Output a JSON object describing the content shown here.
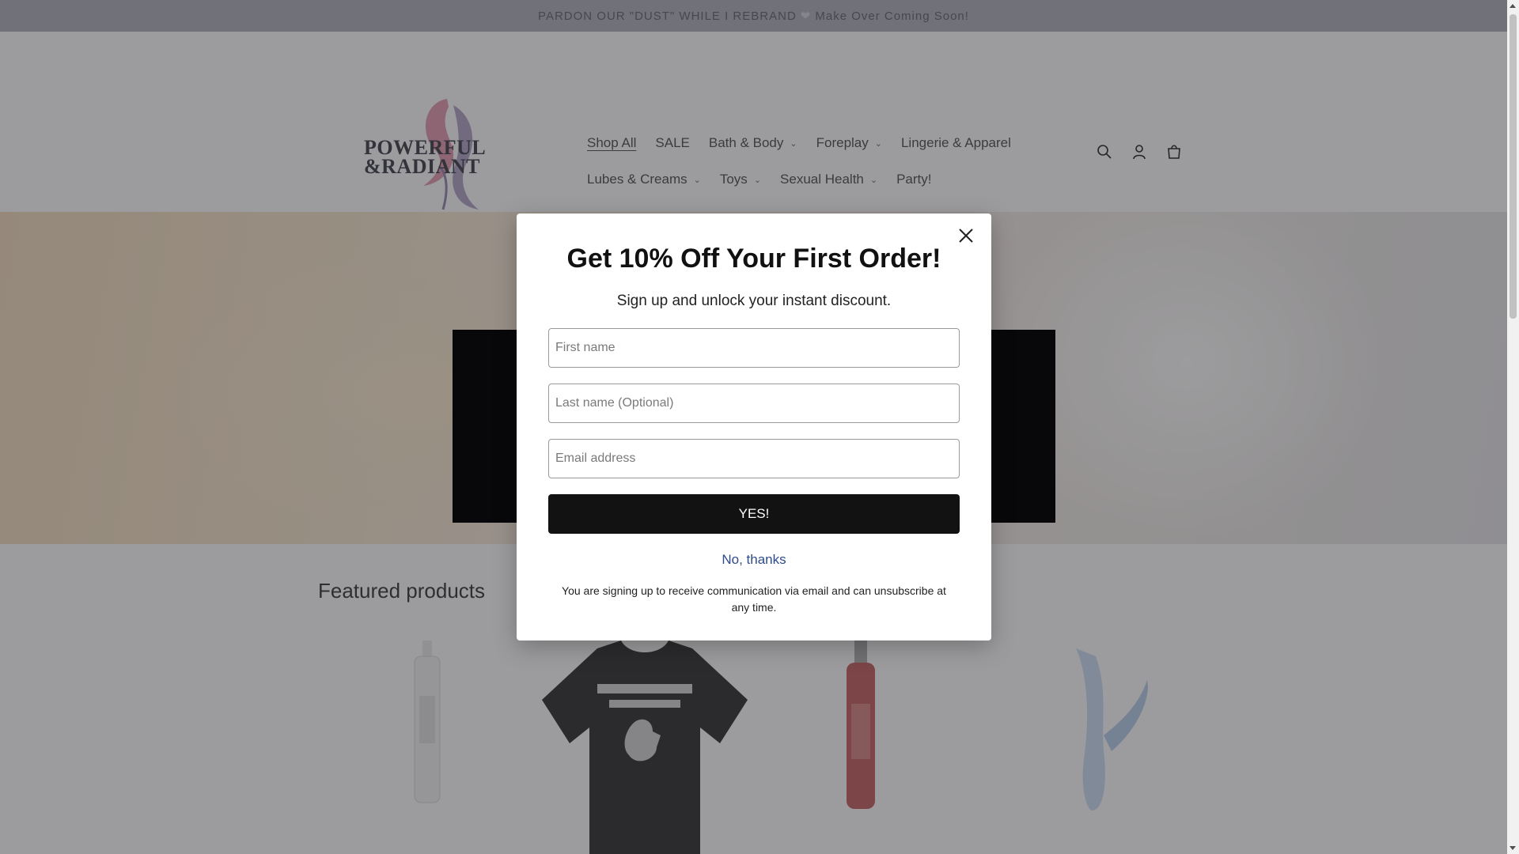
{
  "announcement": {
    "text_before": "PARDON OUR \"DUST\" WHILE I REBRAND",
    "text_after": "Make Over Coming Soon!"
  },
  "brand": {
    "line1": "POWERFUL",
    "line2": "&RADIANT"
  },
  "nav": {
    "row1": [
      {
        "label": "Shop All",
        "dropdown": false
      },
      {
        "label": "SALE",
        "dropdown": false
      },
      {
        "label": "Bath & Body",
        "dropdown": true
      },
      {
        "label": "Foreplay",
        "dropdown": true
      },
      {
        "label": "Lingerie & Apparel",
        "dropdown": false
      }
    ],
    "row2": [
      {
        "label": "Lubes & Creams",
        "dropdown": true
      },
      {
        "label": "Toys",
        "dropdown": true
      },
      {
        "label": "Sexual Health",
        "dropdown": true
      },
      {
        "label": "Party!",
        "dropdown": false
      }
    ]
  },
  "icons": [
    "search-icon",
    "account-icon",
    "cart-icon"
  ],
  "featured": {
    "title": "Featured products"
  },
  "popup": {
    "title": "Get 10% Off Your First Order!",
    "subtitle": "Sign up and unlock your instant discount.",
    "first_name_placeholder": "First name",
    "last_name_placeholder": "Last name (Optional)",
    "email_placeholder": "Email address",
    "submit_label": "YES!",
    "decline_label": "No, thanks",
    "disclaimer": "You are signing up to receive communication via email and can unsubscribe at any time."
  },
  "colors": {
    "accent_dark": "#121212",
    "link_blue": "#2e4b8a",
    "announcement_bg": "#b6b6c0"
  }
}
